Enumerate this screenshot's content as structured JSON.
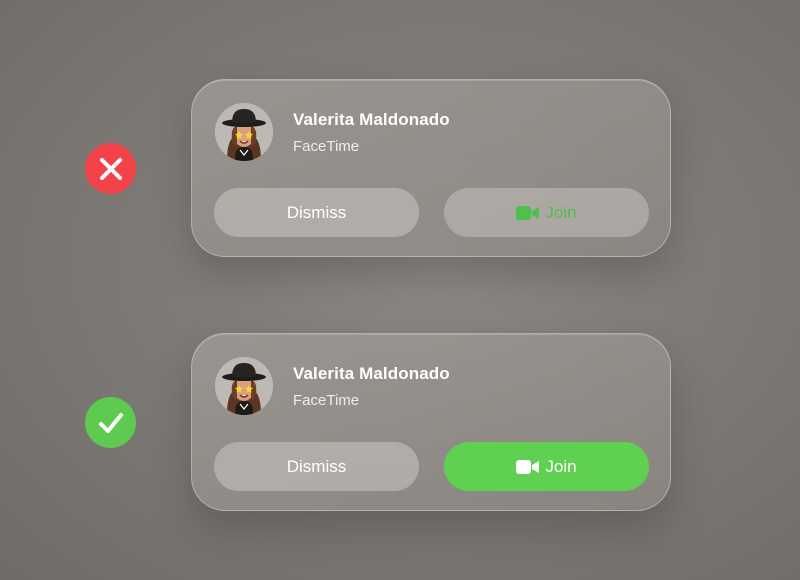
{
  "examples": [
    {
      "verdict": "incorrect",
      "indicator_icon": "x-mark-icon",
      "indicator_color": "#f2434a",
      "notification": {
        "caller_name": "Valerita Maldonado",
        "app_name": "FaceTime",
        "avatar": "memoji-avatar",
        "dismiss_label": "Dismiss",
        "join_label": "Join",
        "join_icon": "video-camera-icon",
        "join_style": "green text on gray background"
      }
    },
    {
      "verdict": "correct",
      "indicator_icon": "checkmark-icon",
      "indicator_color": "#5ecb50",
      "notification": {
        "caller_name": "Valerita Maldonado",
        "app_name": "FaceTime",
        "avatar": "memoji-avatar",
        "dismiss_label": "Dismiss",
        "join_label": "Join",
        "join_icon": "video-camera-icon",
        "join_style": "white text on green background"
      }
    }
  ],
  "colors": {
    "background": "#7e7b77",
    "join_green": "#5fd052",
    "join_text_green": "#4fc04a",
    "bad_red": "#f2434a",
    "good_green": "#5ecb50"
  }
}
